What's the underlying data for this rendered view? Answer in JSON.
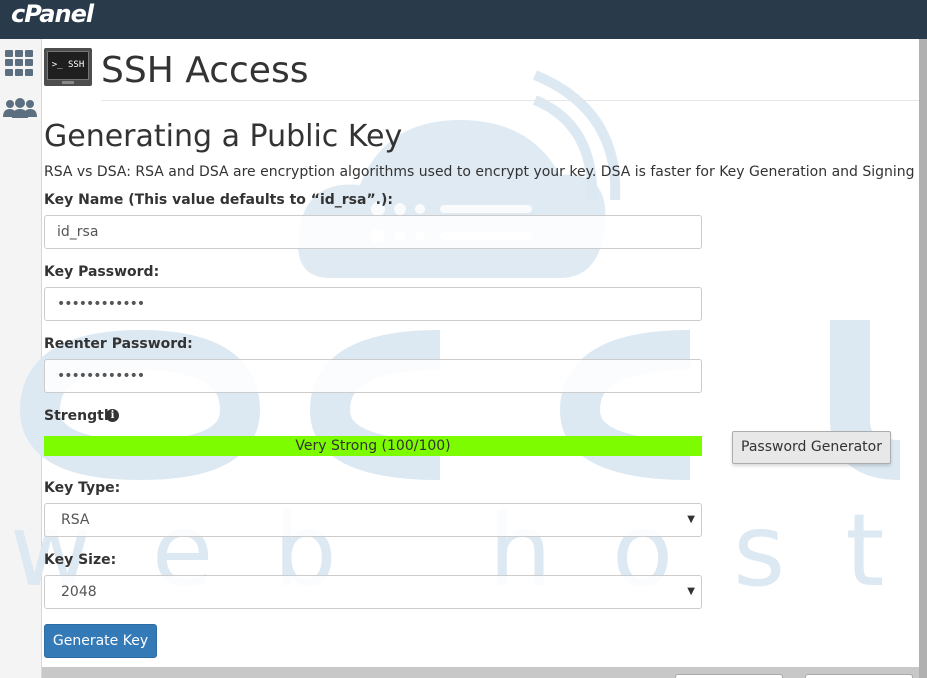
{
  "app": {
    "logo": "cPanel"
  },
  "sidebar": {
    "items": [
      {
        "icon": "grid-icon"
      },
      {
        "icon": "users-icon"
      }
    ]
  },
  "header": {
    "badge_text": ">_ SSH",
    "title": "SSH Access"
  },
  "form": {
    "section_title": "Generating a Public Key",
    "description": "RSA vs DSA: RSA and DSA are encryption algorithms used to encrypt your key. DSA is faster for Key Generation and Signing and RSA is fa",
    "key_name": {
      "label": "Key Name (This value defaults to “id_rsa”.):",
      "value": "id_rsa"
    },
    "key_password": {
      "label": "Key Password:",
      "value": "••••••••••••"
    },
    "reenter_password": {
      "label": "Reenter Password:",
      "value": "••••••••••••"
    },
    "strength": {
      "label": "Strength",
      "text": "Very Strong (100/100)",
      "score": 100,
      "max": 100,
      "color": "#7dfc00"
    },
    "password_generator_label": "Password Generator",
    "key_type": {
      "label": "Key Type:",
      "value": "RSA"
    },
    "key_size": {
      "label": "Key Size:",
      "value": "2048"
    },
    "generate_label": "Generate Key"
  },
  "watermark": {
    "text": "web hosting",
    "color": "#dce8f2"
  },
  "colors": {
    "topbar": "#293a4a",
    "primary": "#337ab7"
  }
}
